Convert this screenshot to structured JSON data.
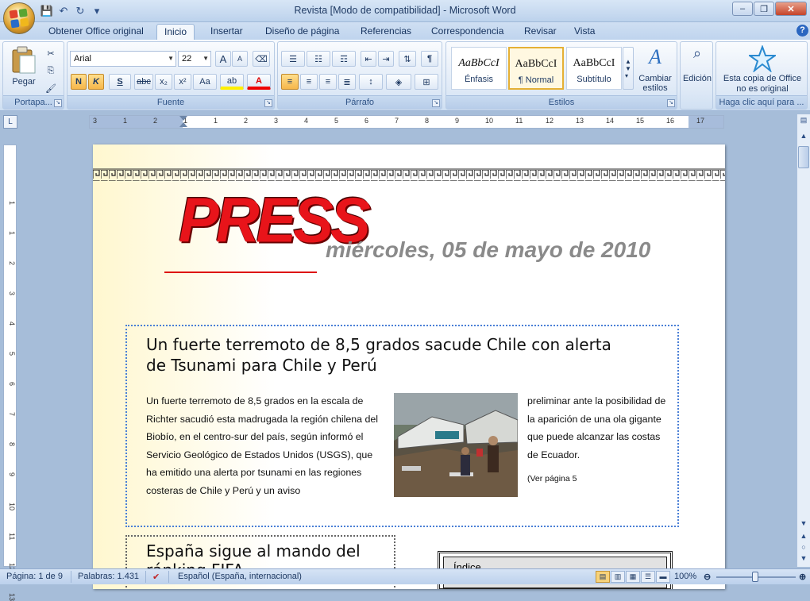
{
  "window": {
    "title": "Revista [Modo de compatibilidad] - Microsoft Word",
    "min": "–",
    "max": "❐",
    "close": "✕"
  },
  "qat": {
    "save": "💾",
    "undo": "↶",
    "redo": "↻",
    "more": "▾"
  },
  "tabs": [
    {
      "label": "Obtener Office original"
    },
    {
      "label": "Inicio"
    },
    {
      "label": "Insertar"
    },
    {
      "label": "Diseño de página"
    },
    {
      "label": "Referencias"
    },
    {
      "label": "Correspondencia"
    },
    {
      "label": "Revisar"
    },
    {
      "label": "Vista"
    }
  ],
  "active_tab": "Inicio",
  "ribbon": {
    "clipboard": {
      "label": "Portapa...",
      "paste": "Pegar"
    },
    "font": {
      "label": "Fuente",
      "name": "Arial",
      "size": "22",
      "bold": "N",
      "italic": "K",
      "underline": "S",
      "strike": "abc",
      "sub": "x₂",
      "sup": "x²",
      "case": "Aa",
      "highlight": "ab",
      "color": "A",
      "grow": "A",
      "shrink": "A"
    },
    "paragraph": {
      "label": "Párrafo",
      "pilcrow": "¶"
    },
    "styles": {
      "label": "Estilos",
      "items": [
        {
          "sample": "AaBbCcI",
          "name": "Énfasis"
        },
        {
          "sample": "AaBbCcI",
          "name": "¶ Normal"
        },
        {
          "sample": "AaBbCcI",
          "name": "Subtítulo"
        }
      ],
      "change": "Cambiar estilos"
    },
    "editing": {
      "label": "Edición"
    },
    "office": {
      "line1": "Esta copia de Office",
      "line2": "no es original",
      "footer": "Haga clic aquí para ..."
    }
  },
  "ruler": {
    "numbers": [
      "3",
      "1",
      "2",
      "1",
      "1",
      "2",
      "3",
      "4",
      "5",
      "6",
      "7",
      "8",
      "9",
      "10",
      "11",
      "12",
      "13",
      "14",
      "15",
      "16",
      "17"
    ],
    "vnumbers": [
      "1",
      "1",
      "2",
      "3",
      "4",
      "5",
      "6",
      "7",
      "8",
      "9",
      "10",
      "11",
      "12",
      "13"
    ]
  },
  "document": {
    "masthead": "PRESS",
    "date": "miércoles, 05 de mayo de 2010",
    "article1": {
      "title": "Un fuerte terremoto de 8,5 grados sacude Chile con alerta de Tsunami para Chile y Perú",
      "col1": "Un fuerte terremoto de 8,5 grados en la escala de Richter sacudió esta madrugada la región chilena del Biobío, en el centro-sur del país, según informó el Servicio Geológico de Estados Unidos (USGS), que ha emitido una alerta por tsunami en las regiones costeras de Chile y Perú y un aviso",
      "col2": "preliminar ante la posibilidad de la aparición de una ola gigante que puede alcanzar las costas de Ecuador.",
      "see_page": "(Ver página 5"
    },
    "article2": {
      "title": "España sigue al mando del ránking FIFA"
    },
    "index": {
      "title": "Índice"
    }
  },
  "status": {
    "page": "Página: 1 de 9",
    "words": "Palabras: 1.431",
    "language": "Español (España, internacional)",
    "zoom": "100%",
    "zoom_level": 100
  }
}
